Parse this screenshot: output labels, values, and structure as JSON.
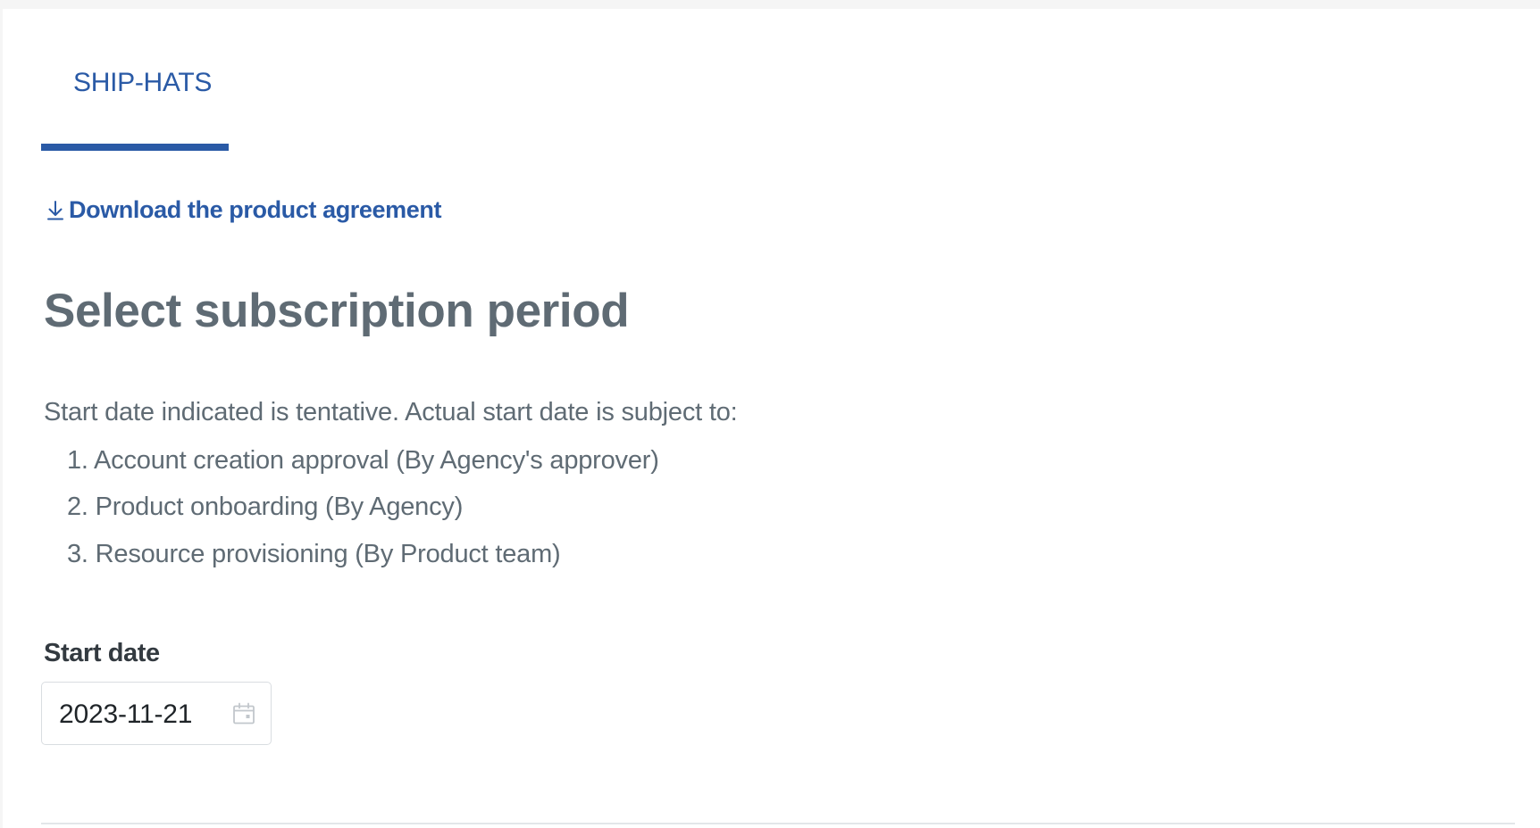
{
  "tabs": [
    {
      "label": "SHIP-HATS",
      "active": true
    }
  ],
  "download": {
    "label": "Download the product agreement",
    "icon": "download-icon"
  },
  "heading": "Select subscription period",
  "intro": "Start date indicated is tentative. Actual start date is subject to:",
  "steps": [
    "1. Account creation approval (By Agency's approver)",
    "2. Product onboarding (By Agency)",
    "3. Resource provisioning (By Product team)"
  ],
  "start_date": {
    "label": "Start date",
    "value": "2023-11-21",
    "icon": "calendar-icon"
  },
  "colors": {
    "accent": "#2a5aa6",
    "text_muted": "#5f6b74",
    "text_strong": "#333a40",
    "border": "#d9dde1"
  }
}
